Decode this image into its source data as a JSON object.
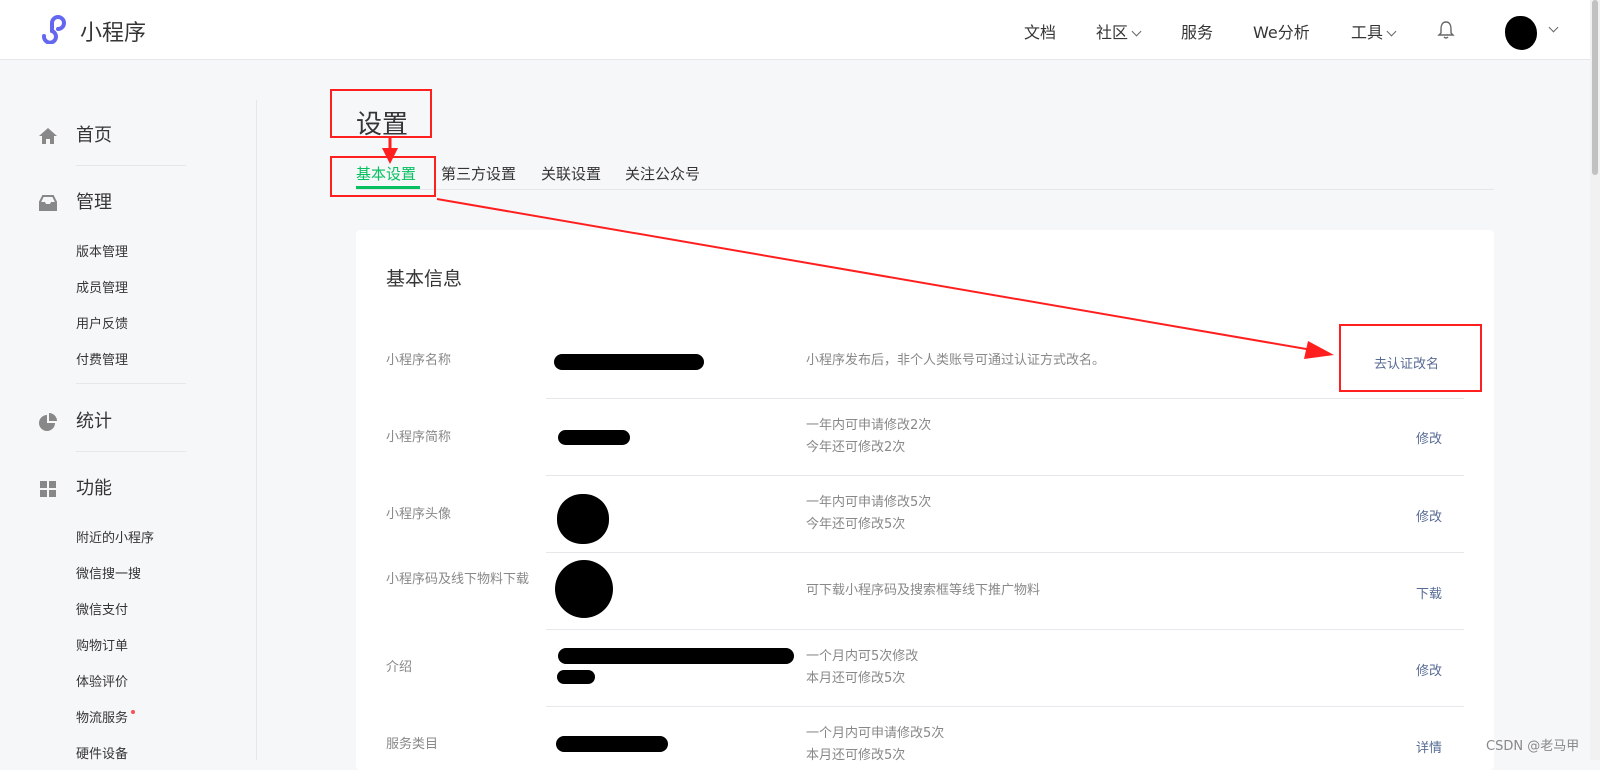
{
  "header": {
    "brand": "小程序",
    "nav": [
      {
        "label": "文档"
      },
      {
        "label": "社区"
      },
      {
        "label": "服务"
      },
      {
        "label": "We分析"
      },
      {
        "label": "工具"
      }
    ]
  },
  "sidebar": {
    "sections": [
      {
        "label": "首页",
        "icon": "home-icon"
      },
      {
        "label": "管理",
        "icon": "inbox-icon",
        "items": [
          "版本管理",
          "成员管理",
          "用户反馈",
          "付费管理"
        ]
      },
      {
        "label": "统计",
        "icon": "pie-chart-icon"
      },
      {
        "label": "功能",
        "icon": "grid-icon",
        "items": [
          "附近的小程序",
          "微信搜一搜",
          "微信支付",
          "购物订单",
          "体验评价",
          "物流服务",
          "硬件设备"
        ]
      }
    ]
  },
  "main": {
    "title": "设置",
    "tabs": [
      "基本设置",
      "第三方设置",
      "关联设置",
      "关注公众号"
    ],
    "active_tab": "基本设置",
    "card_title": "基本信息",
    "rows": [
      {
        "label": "小程序名称",
        "tips": [
          "小程序发布后，非个人类账号可通过认证方式改名。"
        ],
        "action": "去认证改名"
      },
      {
        "label": "小程序简称",
        "tips": [
          "一年内可申请修改2次",
          "今年还可修改2次"
        ],
        "action": "修改"
      },
      {
        "label": "小程序头像",
        "tips": [
          "一年内可申请修改5次",
          "今年还可修改5次"
        ],
        "action": "修改"
      },
      {
        "label": "小程序码及线下物料下载",
        "tips": [
          "可下载小程序码及搜索框等线下推广物料"
        ],
        "action": "下载"
      },
      {
        "label": "介绍",
        "tips": [
          "一个月内可5次修改",
          "本月还可修改5次"
        ],
        "action": "修改"
      },
      {
        "label": "服务类目",
        "tips": [
          "一个月内可申请修改5次",
          "本月还可修改5次"
        ],
        "action": "详情"
      }
    ]
  },
  "watermark": "CSDN @老马甲",
  "colors": {
    "accent": "#07c160",
    "link": "#576b95",
    "annotation": "#ff1f1f"
  }
}
